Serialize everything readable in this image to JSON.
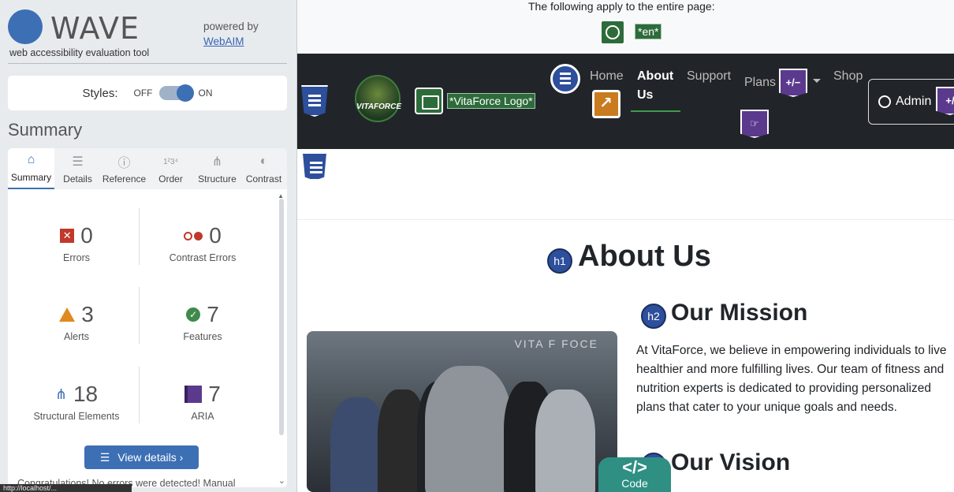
{
  "wave": {
    "name": "WAVE",
    "subtitle": "web accessibility evaluation tool",
    "powered_by": "powered by",
    "webaim": "WebAIM",
    "styles_label": "Styles:",
    "off": "OFF",
    "on": "ON",
    "summary_title": "Summary",
    "tabs": [
      {
        "label": "Summary",
        "icon": "home-icon"
      },
      {
        "label": "Details",
        "icon": "list-icon"
      },
      {
        "label": "Reference",
        "icon": "info-icon"
      },
      {
        "label": "Order",
        "icon": "order-icon"
      },
      {
        "label": "Structure",
        "icon": "structure-icon"
      },
      {
        "label": "Contrast",
        "icon": "contrast-icon"
      }
    ],
    "stats": {
      "errors": {
        "value": "0",
        "label": "Errors"
      },
      "contrast": {
        "value": "0",
        "label": "Contrast Errors"
      },
      "alerts": {
        "value": "3",
        "label": "Alerts"
      },
      "features": {
        "value": "7",
        "label": "Features"
      },
      "structural": {
        "value": "18",
        "label": "Structural Elements"
      },
      "aria": {
        "value": "7",
        "label": "ARIA"
      }
    },
    "view_details": "View details ›",
    "congrats": "Congratulations! No errors were detected! Manual",
    "url_chip": "http://localhost/..."
  },
  "page": {
    "apply_text": "The following apply to the entire page:",
    "lang_tag": "*en*",
    "logo_text": "VITAFORCE",
    "alt_tag": "*VitaForce Logo*",
    "nav": {
      "home": "Home",
      "about_1": "About",
      "about_2": "Us",
      "support": "Support",
      "plans": "Plans",
      "shop": "Shop",
      "admin": "Admin"
    },
    "aria_badge": "+/−",
    "h1_badge": "h1",
    "h2_badge": "h2",
    "about_heading": "About Us",
    "mission_heading": "Our Mission",
    "mission_text": "At VitaForce, we believe in empowering individuals to live healthier and more fulfilling lives. Our team of fitness and nutrition experts is dedicated to providing personalized plans that cater to your unique goals and needs.",
    "vision_heading": "Our Vision",
    "photo_brand": "VITA F FOCE",
    "code_symbol": "</>",
    "code_label": "Code"
  },
  "colors": {
    "wave_blue": "#3d6fb4",
    "feature_green": "#2e6b3b",
    "alert_orange": "#c97b1f",
    "aria_purple": "#5b3a8e",
    "error_red": "#c0392b",
    "nav_bg": "#212529"
  }
}
